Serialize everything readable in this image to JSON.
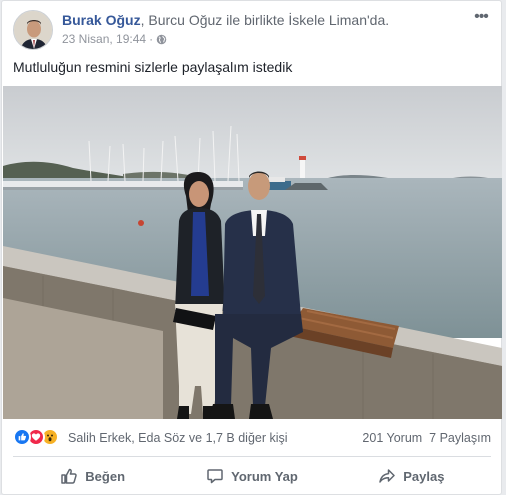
{
  "post": {
    "author_name": "Burak Oğuz",
    "with_text": ", Burcu Oğuz ile birlikte İskele Liman'da.",
    "timestamp": "23 Nisan, 19:44",
    "separator": "·",
    "privacy_icon": "globe-icon",
    "more_icon": "ellipsis-icon",
    "text": "Mutluluğun resmini sizlerle paylaşalım istedik"
  },
  "reactions": {
    "icons": [
      "like-icon",
      "love-icon",
      "wow-icon"
    ],
    "names": "Salih Erkek, Eda Söz ve 1,7 B diğer kişi",
    "comments": "201 Yorum",
    "shares": "7 Paylaşım"
  },
  "actions": {
    "like": "Beğen",
    "comment": "Yorum Yap",
    "share": "Paylaş"
  },
  "colors": {
    "link": "#365899",
    "like_blue": "#1877f2",
    "love_red": "#f0284a",
    "wow_yellow": "#f7b125"
  }
}
